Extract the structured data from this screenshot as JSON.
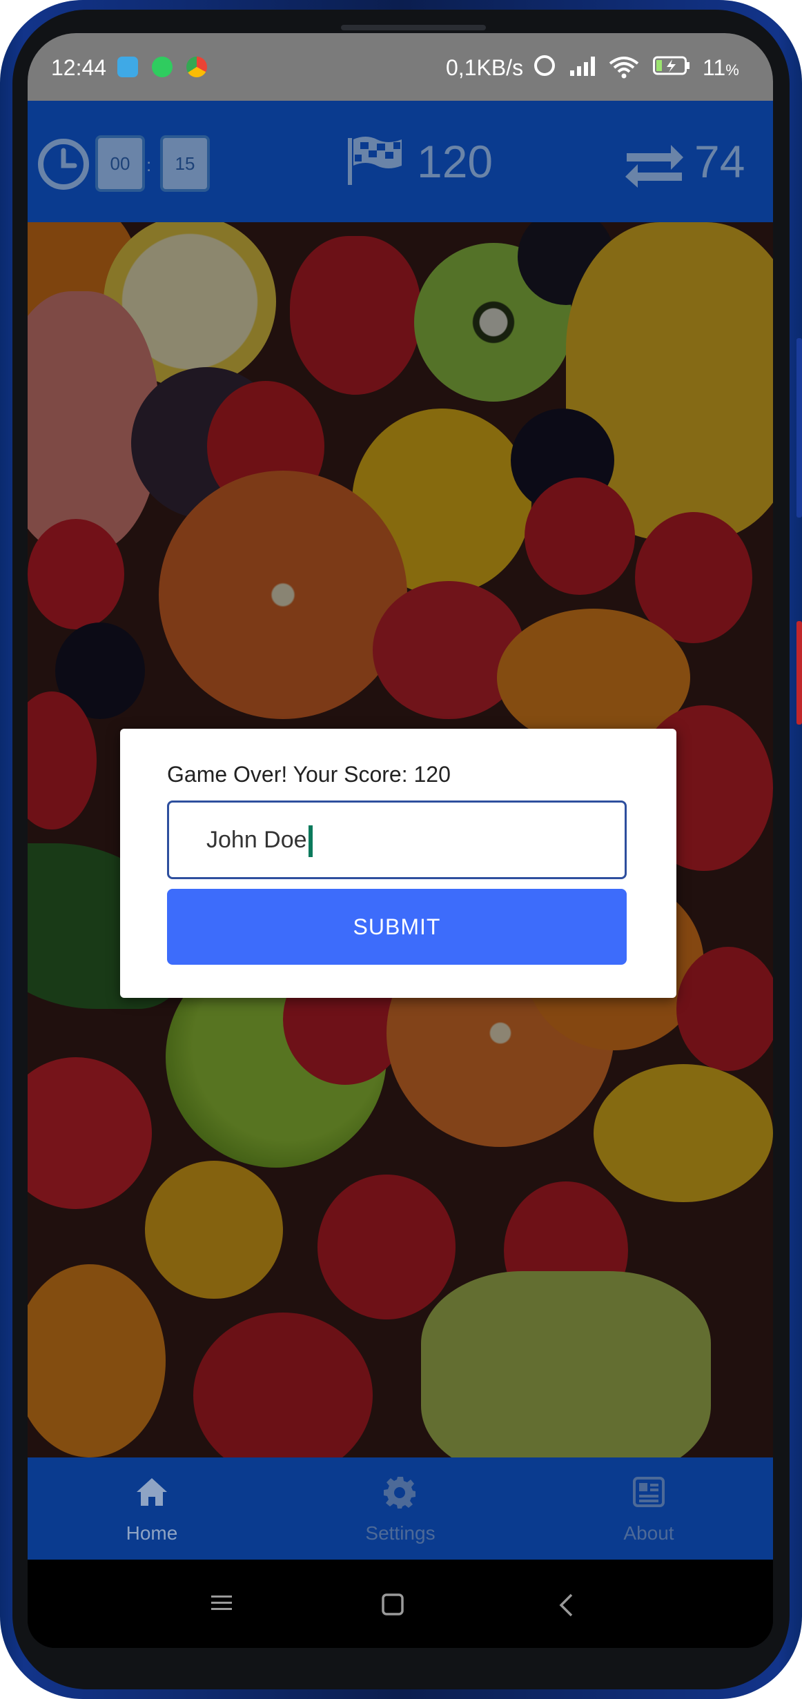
{
  "status_bar": {
    "time": "12:44",
    "network_speed": "0,1KB/s",
    "battery_percent": "11",
    "battery_unit": "%",
    "app_icons": [
      "telegram-icon",
      "whatsapp-icon",
      "chrome-icon"
    ]
  },
  "game_bar": {
    "timer_minutes": "00",
    "timer_separator": ":",
    "timer_seconds": "15",
    "score": "120",
    "moves": "74"
  },
  "dialog": {
    "message": "Game Over! Your Score: 120",
    "name_input_value": "John Doe",
    "submit_label": "SUBMIT"
  },
  "bottom_nav": {
    "items": [
      {
        "label": "Home",
        "icon": "home-icon",
        "active": true
      },
      {
        "label": "Settings",
        "icon": "gear-icon",
        "active": false
      },
      {
        "label": "About",
        "icon": "about-icon",
        "active": false
      }
    ]
  },
  "colors": {
    "bar_blue": "#0a3b8f",
    "submit_blue": "#3d6cfb",
    "input_border": "#2e4f9e"
  }
}
